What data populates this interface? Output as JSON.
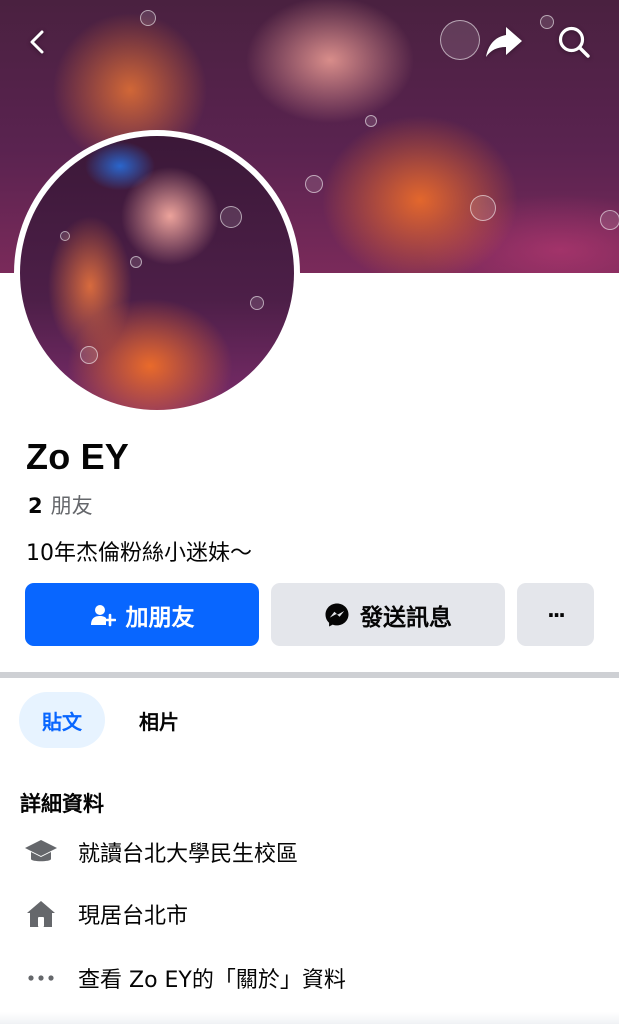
{
  "cover": {
    "image": "cover-photo"
  },
  "header": {
    "back_icon": "chevron-left-icon",
    "share_icon": "share-arrow-icon",
    "search_icon": "search-icon"
  },
  "profile": {
    "name": "Zo EY",
    "friends_count": "2",
    "friends_label": "朋友",
    "bio": "10年杰倫粉絲小迷妹～"
  },
  "actions": {
    "add_friend_label": "加朋友",
    "message_label": "發送訊息",
    "more_label": "···"
  },
  "tabs": [
    {
      "label": "貼文",
      "active": true
    },
    {
      "label": "相片",
      "active": false
    }
  ],
  "details": {
    "title": "詳細資料",
    "items": [
      {
        "icon": "graduation-cap-icon",
        "text": "就讀台北大學民生校區"
      },
      {
        "icon": "home-icon",
        "text": "現居台北市"
      },
      {
        "icon": "more-dots-icon",
        "text": "查看 Zo EY的「關於」資料"
      }
    ]
  },
  "colors": {
    "primary": "#0866ff",
    "secondary_button": "#e4e6eb",
    "tab_active_bg": "#e7f3ff",
    "muted_text": "#65676b"
  }
}
